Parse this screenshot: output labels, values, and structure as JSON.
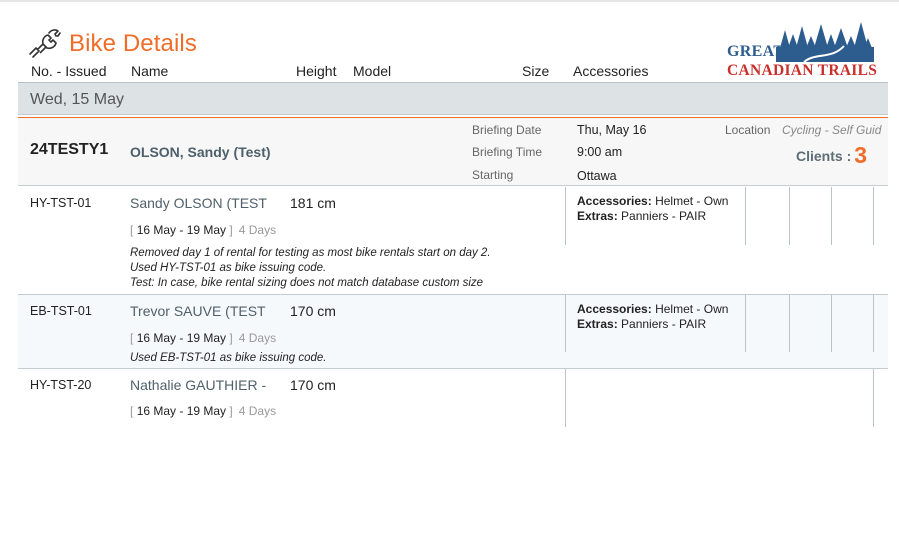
{
  "header": {
    "title": "Bike Details"
  },
  "logo": {
    "line1": "GREAT",
    "line2": "CANADIAN TRAILS"
  },
  "columns": {
    "no_issued": "No. - Issued",
    "name": "Name",
    "height": "Height",
    "model": "Model",
    "size": "Size",
    "accessories": "Accessories"
  },
  "date_band": "Wed, 15 May",
  "booking": {
    "code": "24TESTY1",
    "name": "OLSON, Sandy (Test)",
    "briefing_date_label": "Briefing Date",
    "briefing_date": "Thu, May 16",
    "briefing_time_label": "Briefing Time",
    "briefing_time": "9:00 am",
    "starting_label": "Starting",
    "starting": "Ottawa",
    "location_label": "Location",
    "location": "Cycling - Self Guid",
    "clients_label": "Clients :",
    "clients_count": "3"
  },
  "rows": [
    {
      "code": "HY-TST-01",
      "name": "Sandy OLSON (TEST",
      "height": "181 cm",
      "date_open": "[",
      "dates": "16 May - 19 May",
      "date_close": "]",
      "days": "4 Days",
      "accessories_label": "Accessories:",
      "accessories": "Helmet - Own",
      "extras_label": "Extras:",
      "extras": "Panniers - PAIR",
      "notes": [
        "Removed day 1 of rental for testing as most bike rentals start on day 2.",
        "Used HY-TST-01 as bike issuing code.",
        "Test: In case, bike rental sizing does not match database custom size"
      ]
    },
    {
      "code": "EB-TST-01",
      "name": "Trevor SAUVE (TEST",
      "height": "170 cm",
      "date_open": "[",
      "dates": "16 May - 19 May",
      "date_close": "]",
      "days": "4 Days",
      "accessories_label": "Accessories:",
      "accessories": "Helmet - Own",
      "extras_label": "Extras:",
      "extras": "Panniers - PAIR",
      "notes": [
        "Used EB-TST-01 as bike issuing code."
      ]
    },
    {
      "code": "HY-TST-20",
      "name": "Nathalie GAUTHIER -",
      "height": "170 cm",
      "date_open": "[",
      "dates": "16 May - 19 May",
      "date_close": "]",
      "days": "4 Days"
    }
  ],
  "colors": {
    "accent": "#ef6d28",
    "band": "#dde3e5",
    "name_text": "#50606a",
    "logo_blue": "#2d5c8f",
    "logo_red": "#c9302c"
  },
  "icons": {
    "header": "bike-repair-icon"
  }
}
